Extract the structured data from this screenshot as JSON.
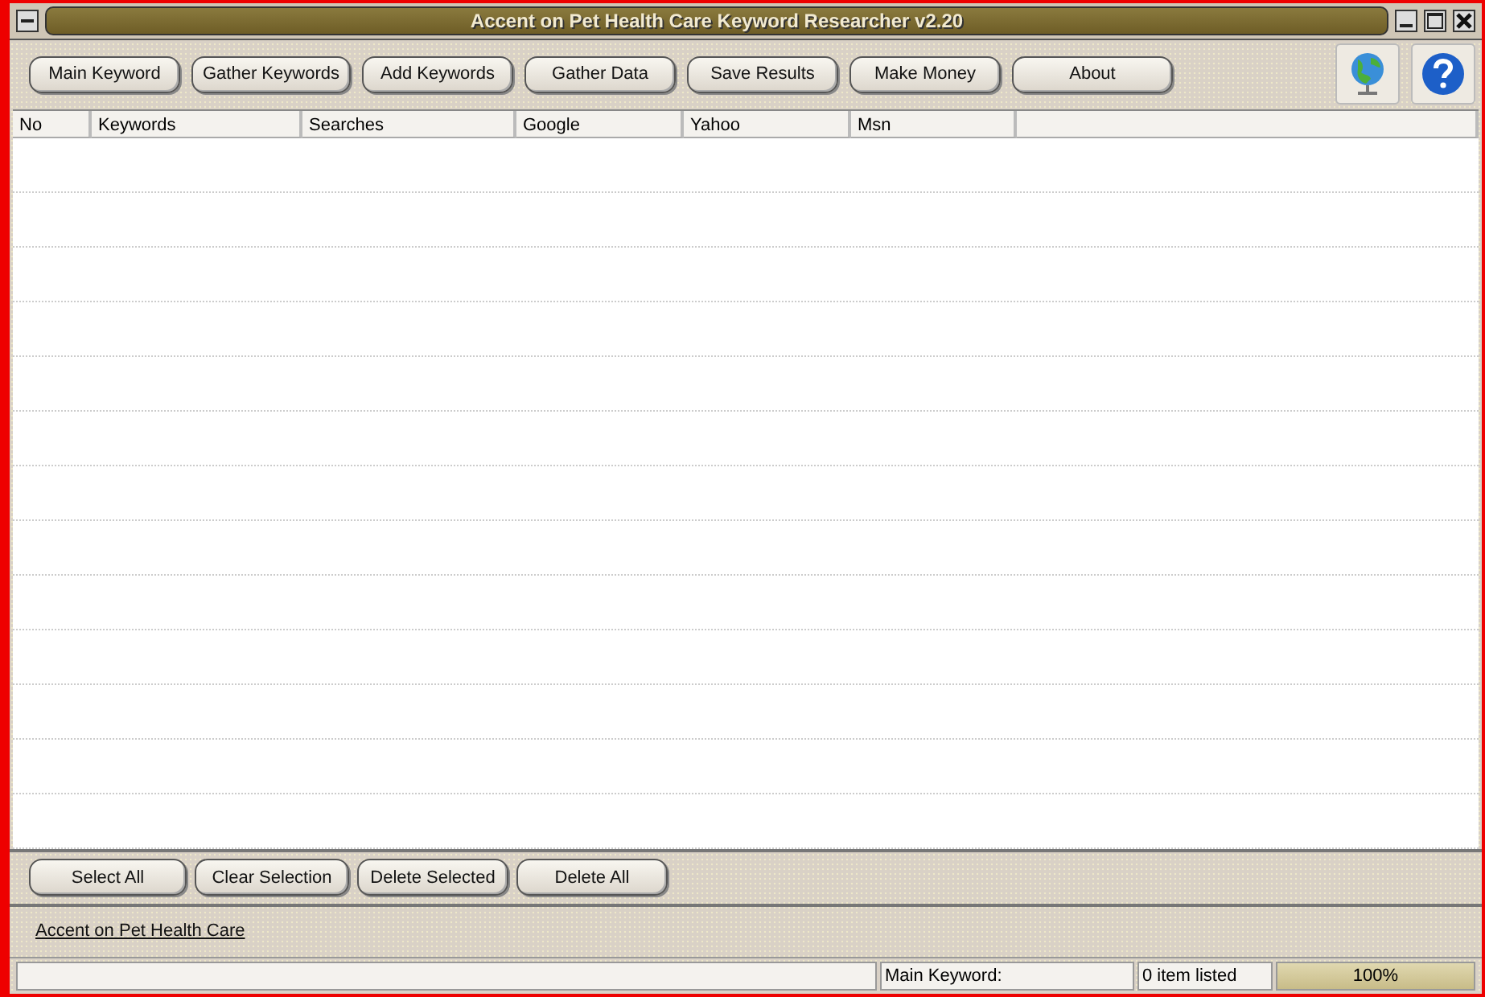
{
  "window": {
    "title": "Accent on Pet Health Care Keyword Researcher v2.20"
  },
  "toolbar": {
    "buttons": [
      "Main Keyword",
      "Gather Keywords",
      "Add Keywords",
      "Gather Data",
      "Save Results",
      "Make Money",
      "About"
    ]
  },
  "table": {
    "columns": [
      "No",
      "Keywords",
      "Searches",
      "Google",
      "Yahoo",
      "Msn"
    ]
  },
  "actions": [
    "Select All",
    "Clear Selection",
    "Delete Selected",
    "Delete All"
  ],
  "link": "Accent on Pet Health Care ",
  "status_bar": {
    "main_keyword_label": "Main Keyword:",
    "count": "0 item listed",
    "progress": {
      "level": 1,
      "reading": "100%"
    }
  }
}
